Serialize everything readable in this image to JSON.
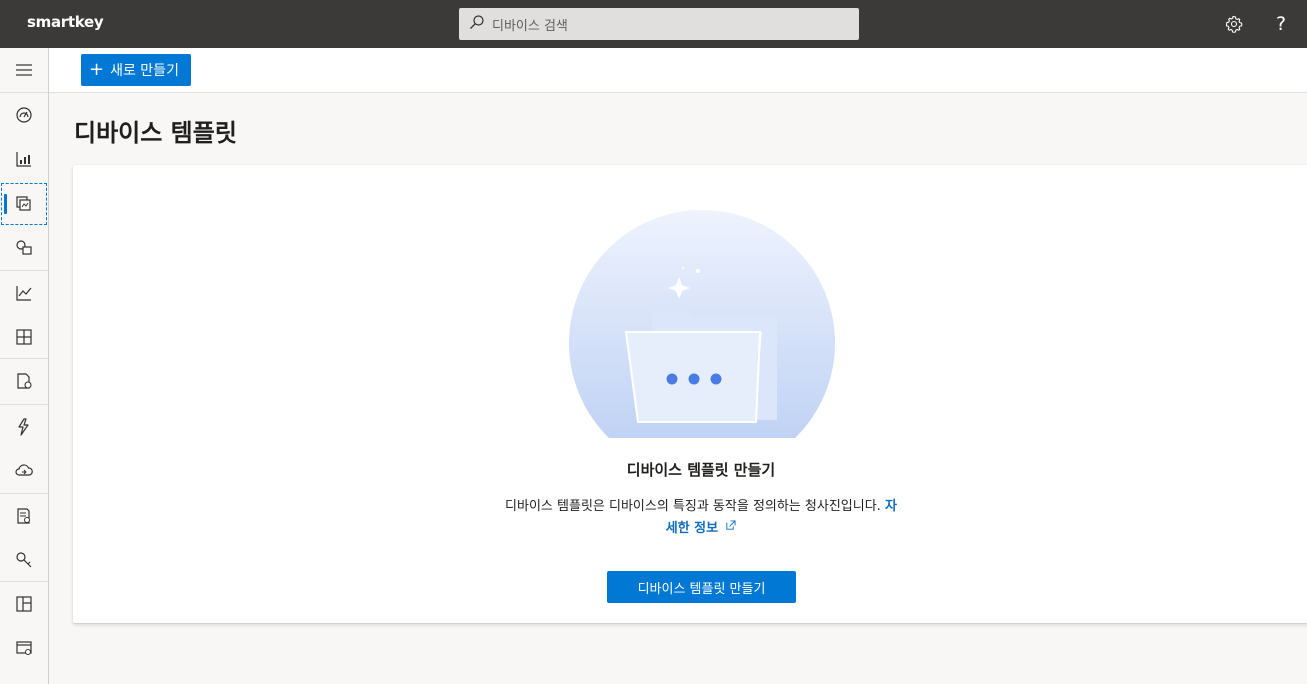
{
  "app": {
    "brand": "smartkey"
  },
  "search": {
    "placeholder": "디바이스 검색"
  },
  "header": {
    "settings_icon": "gear-icon",
    "help_label": "?"
  },
  "sidebar": {
    "items": [
      {
        "icon": "hamburger-menu-icon"
      },
      {
        "icon": "dashboard-icon"
      },
      {
        "icon": "devices-icon"
      },
      {
        "icon": "device-templates-icon",
        "active": true
      },
      {
        "icon": "device-groups-icon"
      },
      {
        "icon": "analytics-icon"
      },
      {
        "icon": "grid-layout-icon"
      },
      {
        "icon": "jobs-icon"
      },
      {
        "icon": "rules-icon"
      },
      {
        "icon": "data-export-icon"
      },
      {
        "icon": "audit-log-icon"
      },
      {
        "icon": "permissions-icon"
      },
      {
        "icon": "application-icon"
      },
      {
        "icon": "customization-icon"
      }
    ]
  },
  "toolbar": {
    "new_label": "새로 만들기"
  },
  "main": {
    "title": "디바이스 템플릿",
    "empty": {
      "title": "디바이스 템플릿 만들기",
      "description": "디바이스 템플릿은 디바이스의 특징과 동작을 정의하는 청사진입니다.",
      "link_text": "자세한 정보",
      "button_label": "디바이스 템플릿 만들기"
    }
  },
  "colors": {
    "accent": "#0078d4",
    "topbar": "#3b3a39",
    "link": "#0f6cbd"
  }
}
